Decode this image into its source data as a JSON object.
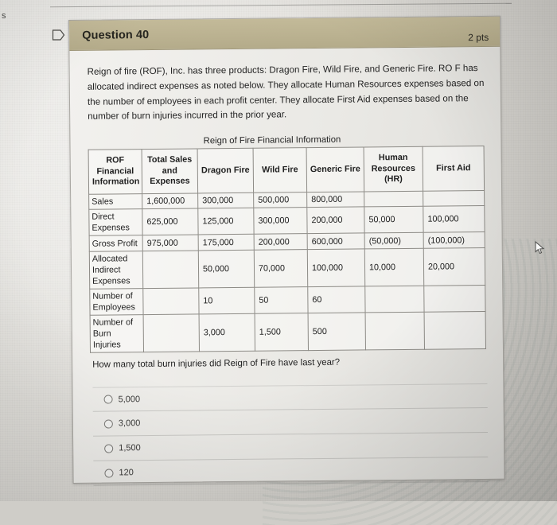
{
  "scene": {
    "edge_text_fragment": "s",
    "flag_icon": "bookmark-flag-icon",
    "cursor_icon": "mouse-pointer-icon"
  },
  "question": {
    "title": "Question 40",
    "points": "2 pts",
    "stem": "Reign of fire (ROF), Inc. has three products:  Dragon Fire, Wild Fire, and Generic Fire.  RO F has allocated indirect expenses as noted below.  They allocate Human Resources expenses based on the number of employees in each profit center.  They allocate First Aid expenses based on the number of burn injuries incurred in the prior year.",
    "sub_question": "How many total burn injuries did Reign of Fire have last year?"
  },
  "table": {
    "caption": "Reign of Fire Financial Information",
    "headers": [
      "ROF Financial Information",
      "Total Sales and Expenses",
      "Dragon Fire",
      "Wild Fire",
      "Generic Fire",
      "Human Resources (HR)",
      "First Aid"
    ],
    "rows": [
      {
        "label": "Sales",
        "total": "1,600,000",
        "dragon": "300,000",
        "wild": "500,000",
        "generic": "800,000",
        "hr": "",
        "firstaid": ""
      },
      {
        "label": "Direct Expenses",
        "total": "625,000",
        "dragon": "125,000",
        "wild": "300,000",
        "generic": "200,000",
        "hr": "50,000",
        "firstaid": "100,000"
      },
      {
        "label": "Gross Profit",
        "total": "975,000",
        "dragon": "175,000",
        "wild": "200,000",
        "generic": "600,000",
        "hr": "(50,000)",
        "firstaid": "(100,000)"
      },
      {
        "label": "Allocated Indirect Expenses",
        "total": "",
        "dragon": "50,000",
        "wild": "70,000",
        "generic": "100,000",
        "hr": "10,000",
        "firstaid": "20,000"
      },
      {
        "label": "Number of Employees",
        "total": "",
        "dragon": "10",
        "wild": "50",
        "generic": "60",
        "hr": "",
        "firstaid": ""
      },
      {
        "label": "Number of Burn Injuries",
        "total": "",
        "dragon": "3,000",
        "wild": "1,500",
        "generic": "500",
        "hr": "",
        "firstaid": ""
      }
    ]
  },
  "answers": [
    {
      "label": "5,000",
      "selected": false
    },
    {
      "label": "3,000",
      "selected": false
    },
    {
      "label": "1,500",
      "selected": false
    },
    {
      "label": "120",
      "selected": false
    }
  ],
  "colors": {
    "header_bar": "#bbb291",
    "card_background": "#eae9e5",
    "page_background": "#d5d3ce",
    "table_border": "#8d8b86",
    "text": "#232323"
  }
}
